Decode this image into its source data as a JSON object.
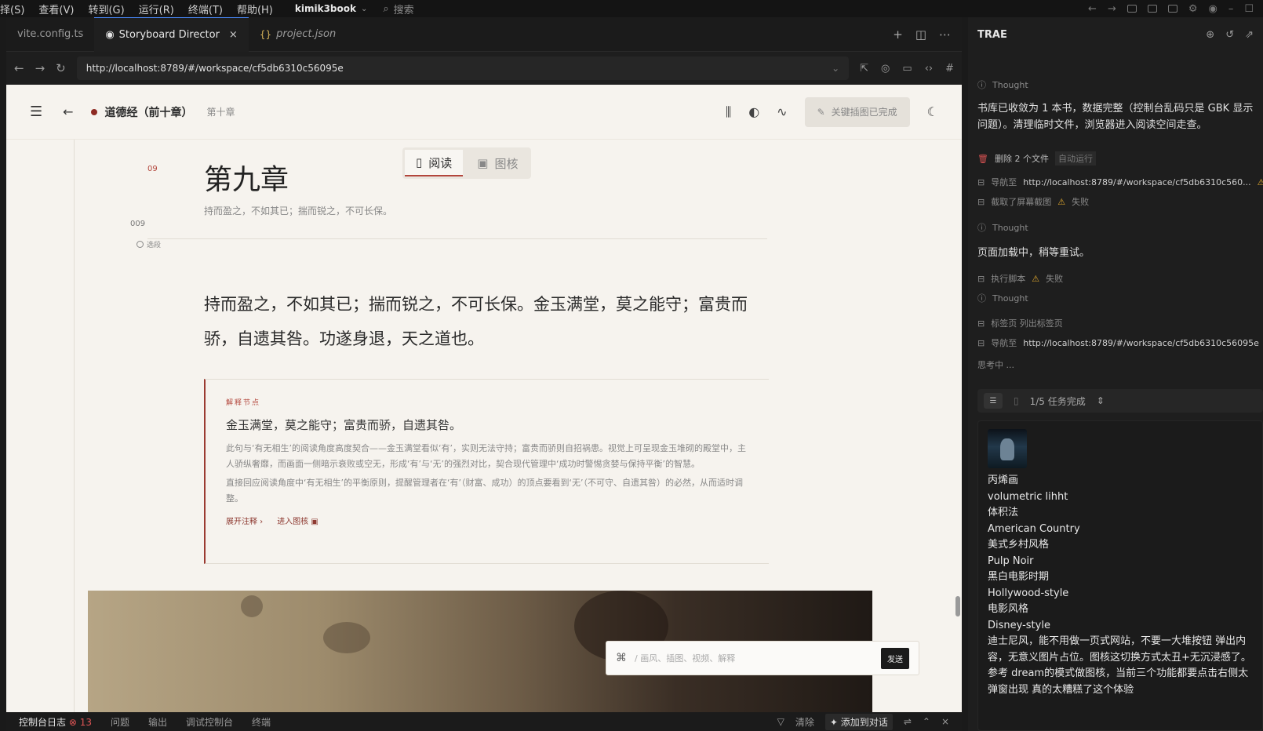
{
  "menu": {
    "items": [
      "择(S)",
      "查看(V)",
      "转到(G)",
      "运行(R)",
      "终端(T)",
      "帮助(H)"
    ],
    "project": "kimik3book",
    "search_placeholder": "搜索"
  },
  "tabs": [
    {
      "label": "vite.config.ts"
    },
    {
      "label": "Storyboard Director"
    },
    {
      "label": "project.json"
    }
  ],
  "browser": {
    "url": "http://localhost:8789/#/workspace/cf5db6310c56095e"
  },
  "app": {
    "book_title": "道德经（前十章）",
    "chapter_label": "第十章",
    "done_button": "关键插图已完成",
    "mode_read": "阅读",
    "mode_graph": "图核"
  },
  "chapter": {
    "marker": "09",
    "index": "009",
    "select_label": "选段",
    "title": "第九章",
    "subtitle": "持而盈之，不如其已；揣而锐之，不可长保。",
    "text": "持而盈之，不如其已；揣而锐之，不可长保。金玉满堂，莫之能守；富贵而骄，自遗其咎。功遂身退，天之道也。"
  },
  "annotation": {
    "label": "解释节点",
    "heading": "金玉满堂，莫之能守；富贵而骄，自遗其咎。",
    "para1": "此句与‘有无相生’的阅读角度高度契合——金玉满堂看似‘有’，实则无法守持；富贵而骄则自招祸患。视觉上可呈现金玉堆砌的殿堂中，主人骄纵奢靡，而画面一侧暗示衰败或空无，形成‘有’与‘无’的强烈对比，契合现代管理中‘成功时警惕贪婪与保持平衡’的智慧。",
    "para2": "直接回应阅读角度中‘有无相生’的平衡原则，提醒管理者在‘有’（财富、成功）的顶点要看到‘无’（不可守、自遗其咎）的必然，从而适时调整。",
    "link_expand": "展开注释",
    "link_graph": "进入图核"
  },
  "chatbox": {
    "placeholder": "/ 画风、插图、视频、解释",
    "send": "发送"
  },
  "bottom_panel": {
    "tab_console": "控制台日志",
    "error_count": "13",
    "tab_problems": "问题",
    "tab_output": "输出",
    "tab_debug": "调试控制台",
    "tab_terminal": "终端",
    "clear": "清除",
    "add_to_chat": "添加到对话"
  },
  "side": {
    "title": "TRAE",
    "thought1": "Thought",
    "msg1": "书库已收敛为 1 本书，数据完整（控制台乱码只是 GBK 显示问题）。清理临时文件，浏览器进入阅读空间走查。",
    "delete_label": "删除 2 个文件",
    "auto_run": "自动运行",
    "nav1_label": "导航至",
    "nav1_url": "http://localhost:8789/#/workspace/cf5db6310c560...",
    "screenshot_label": "截取了屏幕截图",
    "failed": "失败",
    "thought2": "Thought",
    "msg2": "页面加载中，稍等重试。",
    "exec_label": "执行脚本",
    "thought3": "Thought",
    "tabs_label": "标签页 列出标签页",
    "nav2_label": "导航至",
    "nav2_url": "http://localhost:8789/#/workspace/cf5db6310c56095e",
    "thinking": "思考中 ...",
    "task_status": "1/5 任务完成",
    "user_lines": [
      "丙烯画",
      "volumetric lihht",
      "体积法",
      "American Country",
      "美式乡村风格",
      "Pulp Noir",
      "黑白电影时期",
      "Hollywood-style",
      "电影风格",
      "Disney-style",
      "迪士尼风，能不用做一页式网站，不要一大堆按钮 弹出内容，无意义图片占位。图核这切换方式太丑+无沉浸感了。参考 dream的模式做图核，当前三个功能都要点击右侧太弹窗出现 真的太糟糕了这个体验"
    ]
  }
}
